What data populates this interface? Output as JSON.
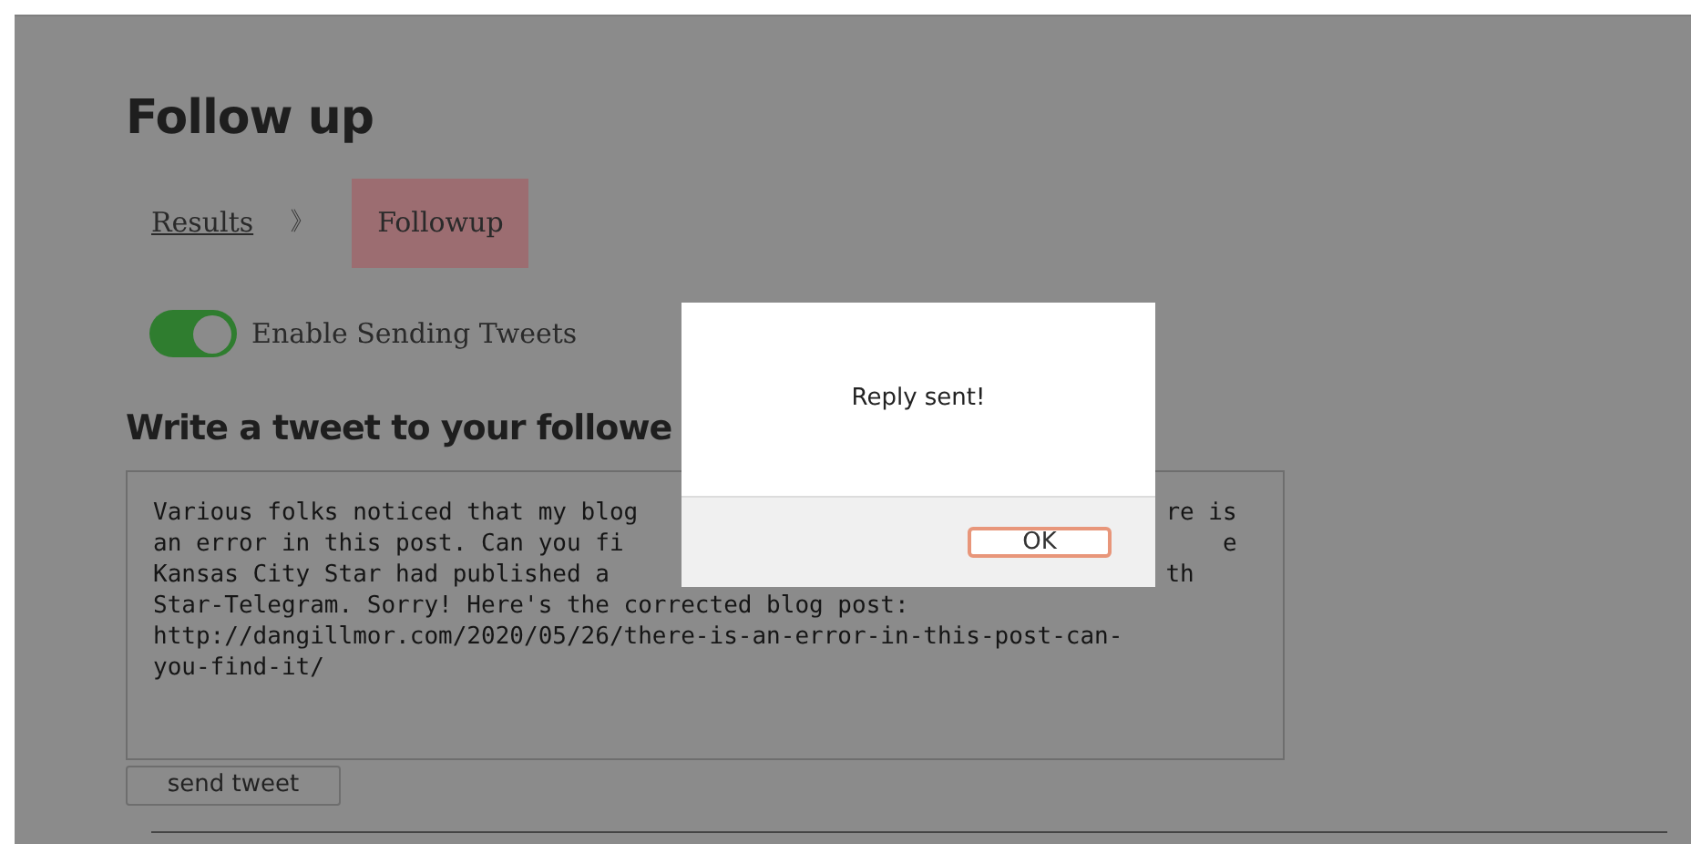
{
  "page": {
    "title": "Follow up"
  },
  "breadcrumb": [
    {
      "label": "Results",
      "selected": false
    },
    {
      "label": "Followup",
      "selected": true
    }
  ],
  "breadcrumb_separator": "》",
  "toggle": {
    "label": "Enable Sending Tweets",
    "on": true
  },
  "compose": {
    "heading": "Write a tweet to your followe",
    "lines": [
      {
        "left": "Various folks noticed that my blog",
        "right": "re is"
      },
      {
        "left": "an error in this post. Can you fi",
        "right": "e"
      },
      {
        "left": "Kansas City Star had published a",
        "right": "th"
      },
      {
        "left": "Star-Telegram. Sorry! Here's the corrected blog post:"
      },
      {
        "left": "http://dangillmor.com/2020/05/26/there-is-an-error-in-this-post-can-"
      },
      {
        "left": "you-find-it/"
      }
    ],
    "button": "send tweet"
  },
  "dialog": {
    "message": "Reply sent!",
    "button": "OK"
  }
}
